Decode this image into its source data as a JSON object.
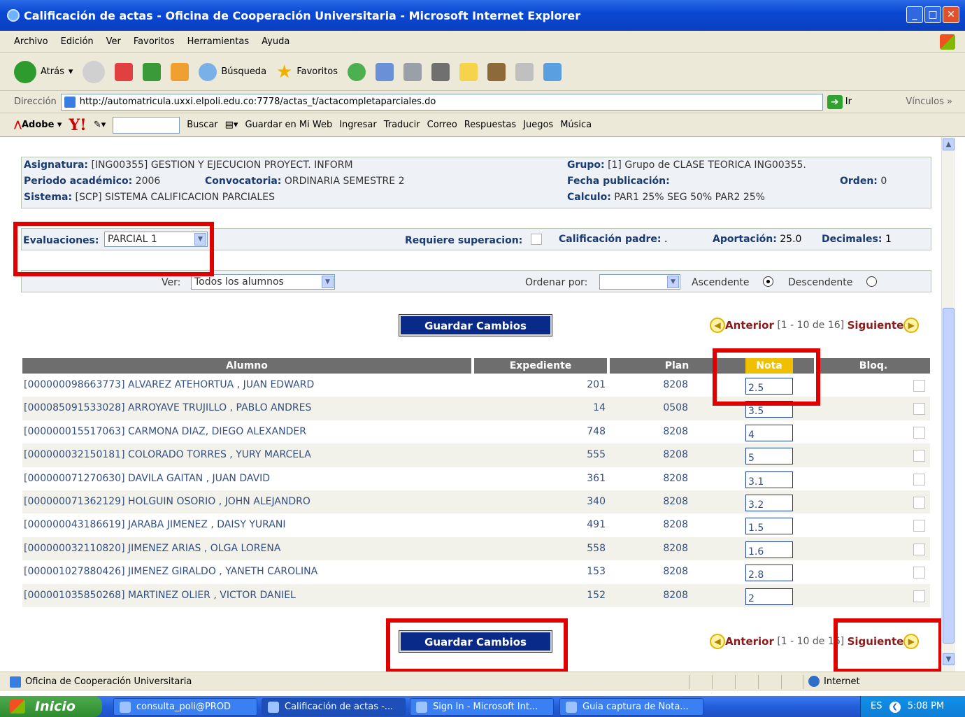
{
  "window": {
    "title": "Calificación de actas - Oficina de Cooperación Universitaria - Microsoft Internet Explorer"
  },
  "menu": [
    "Archivo",
    "Edición",
    "Ver",
    "Favoritos",
    "Herramientas",
    "Ayuda"
  ],
  "toolbar": {
    "back": "Atrás",
    "search": "Búsqueda",
    "favorites": "Favoritos"
  },
  "address": {
    "label": "Dirección",
    "url": "http://automatricula.uxxi.elpoli.edu.co:7778/actas_t/actacompletaparciales.do",
    "go": "Ir",
    "links": "Vínculos"
  },
  "yahoo": {
    "adobe": "Adobe",
    "search": "Buscar",
    "save": "Guardar en Mi Web",
    "login": "Ingresar",
    "translate": "Traducir",
    "mail": "Correo",
    "answers": "Respuestas",
    "games": "Juegos",
    "music": "Música"
  },
  "info": {
    "asignatura_label": "Asignatura:",
    "asignatura": "[ING00355] GESTION Y EJECUCION PROYECT. INFORM",
    "periodo_label": "Periodo académico:",
    "periodo": "2006",
    "convocatoria_label": "Convocatoria:",
    "convocatoria": "ORDINARIA SEMESTRE 2",
    "sistema_label": "Sistema:",
    "sistema": "[SCP] SISTEMA CALIFICACION PARCIALES",
    "grupo_label": "Grupo:",
    "grupo": "[1] Grupo de CLASE TEORICA ING00355.",
    "fecha_label": "Fecha publicación:",
    "orden_label": "Orden:",
    "orden": "0",
    "calculo_label": "Calculo:",
    "calculo": "PAR1 25% SEG 50% PAR2 25%"
  },
  "evals": {
    "label": "Evaluaciones:",
    "selected": "PARCIAL 1",
    "requiere_label": "Requiere superacion:",
    "padre_label": "Calificación padre:",
    "padre": ".",
    "aportacion_label": "Aportación:",
    "aportacion": "25.0",
    "decimales_label": "Decimales:",
    "decimales": "1"
  },
  "filter": {
    "ver_label": "Ver:",
    "ver": "Todos los alumnos",
    "ordenar_label": "Ordenar por:",
    "asc": "Ascendente",
    "desc": "Descendente",
    "asc_selected": true
  },
  "save_label": "Guardar Cambios",
  "pager": {
    "prev": "Anterior",
    "range": "[1 - 10 de 16]",
    "next": "Siguiente"
  },
  "table": {
    "headers": [
      "Alumno",
      "Expediente",
      "Plan",
      "Nota",
      "Bloq."
    ],
    "rows": [
      {
        "alumno": "[000000098663773] ALVAREZ ATEHORTUA , JUAN EDWARD",
        "expediente": "201",
        "plan": "8208",
        "nota": "2.5"
      },
      {
        "alumno": "[000085091533028] ARROYAVE TRUJILLO , PABLO ANDRES",
        "expediente": "14",
        "plan": "0508",
        "nota": "3.5"
      },
      {
        "alumno": "[000000015517063] CARMONA DIAZ, DIEGO ALEXANDER",
        "expediente": "748",
        "plan": "8208",
        "nota": "4"
      },
      {
        "alumno": "[000000032150181] COLORADO TORRES , YURY MARCELA",
        "expediente": "555",
        "plan": "8208",
        "nota": "5"
      },
      {
        "alumno": "[000000071270630] DAVILA GAITAN , JUAN DAVID",
        "expediente": "361",
        "plan": "8208",
        "nota": "3.1"
      },
      {
        "alumno": "[000000071362129] HOLGUIN OSORIO , JOHN ALEJANDRO",
        "expediente": "340",
        "plan": "8208",
        "nota": "3.2"
      },
      {
        "alumno": "[000000043186619] JARABA JIMENEZ , DAISY YURANI",
        "expediente": "491",
        "plan": "8208",
        "nota": "1.5"
      },
      {
        "alumno": "[000000032110820] JIMENEZ ARIAS , OLGA LORENA",
        "expediente": "558",
        "plan": "8208",
        "nota": "1.6"
      },
      {
        "alumno": "[000001027880426] JIMENEZ GIRALDO , YANETH CAROLINA",
        "expediente": "153",
        "plan": "8208",
        "nota": "2.8"
      },
      {
        "alumno": "[000001035850268] MARTINEZ OLIER , VICTOR DANIEL",
        "expediente": "152",
        "plan": "8208",
        "nota": "2"
      }
    ]
  },
  "status": {
    "text": "Oficina de Cooperación Universitaria",
    "zone": "Internet"
  },
  "taskbar": {
    "start": "Inicio",
    "tasks": [
      "consulta_poli@PROD",
      "Calificación de actas -...",
      "Sign In - Microsoft Int...",
      "Guia captura de Nota..."
    ],
    "lang": "ES",
    "time": "5:08 PM"
  },
  "colors": {
    "header_bg": "#6e6e6e",
    "nota_header": "#f0c000",
    "highlight": "#e00000",
    "button": "#0a2a8a",
    "link": "#8b1a1a"
  }
}
